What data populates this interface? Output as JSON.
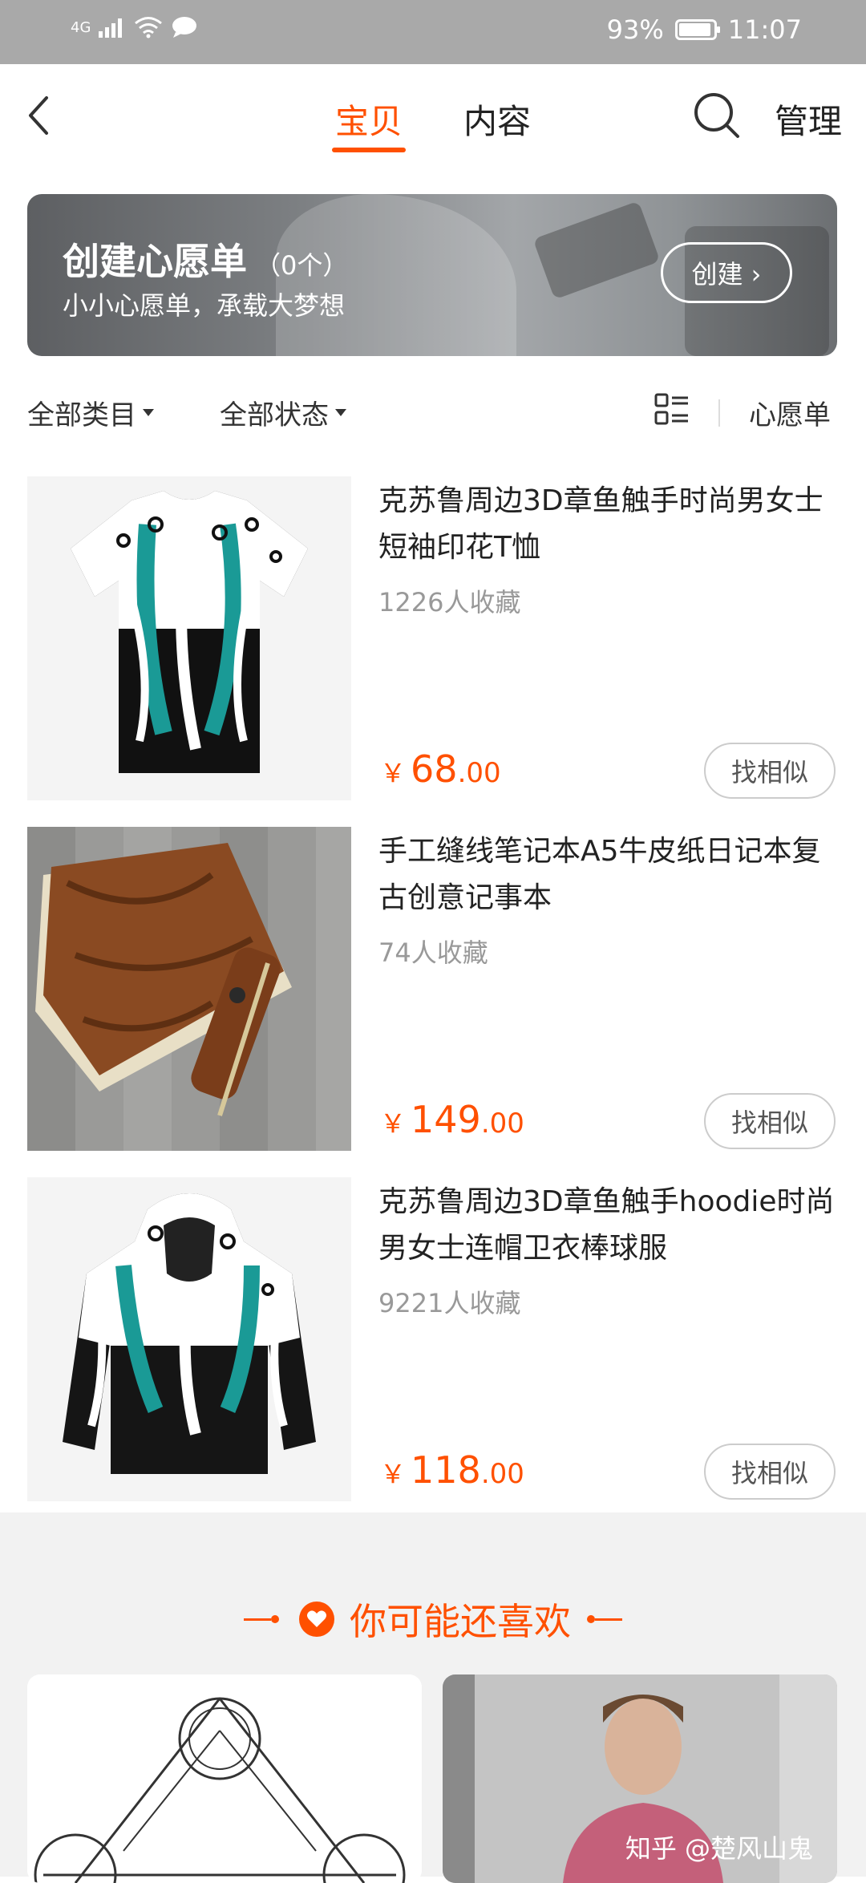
{
  "status_bar": {
    "network": "4G",
    "battery": "93%",
    "battery_level": 0.93,
    "time": "11:07"
  },
  "header": {
    "tab_active": "宝贝",
    "tab_other": "内容",
    "manage": "管理"
  },
  "banner": {
    "title": "创建心愿单",
    "count": "（0个）",
    "subtitle": "小小心愿单，承载大梦想",
    "button": "创建 ›"
  },
  "filters": {
    "category": "全部类目",
    "status": "全部状态",
    "wishlist": "心愿单"
  },
  "products": [
    {
      "title": "克苏鲁周边3D章鱼触手时尚男女士短袖印花T恤",
      "fav": "1226人收藏",
      "price_symbol": "￥",
      "price_int": "68",
      "price_dec": ".00",
      "similar": "找相似"
    },
    {
      "title": "手工缝线笔记本A5牛皮纸日记本复古创意记事本",
      "fav": "74人收藏",
      "price_symbol": "￥",
      "price_int": "149",
      "price_dec": ".00",
      "similar": "找相似"
    },
    {
      "title": "克苏鲁周边3D章鱼触手hoodie时尚男女士连帽卫衣棒球服",
      "fav": "9221人收藏",
      "price_symbol": "￥",
      "price_int": "118",
      "price_dec": ".00",
      "similar": "找相似"
    }
  ],
  "recommendations": {
    "title": "你可能还喜欢",
    "watermark": "知乎 @楚风山鬼"
  },
  "colors": {
    "accent": "#ff5000",
    "status_bar": "#a9a9a9",
    "recs_bg": "#f2f2f2"
  }
}
